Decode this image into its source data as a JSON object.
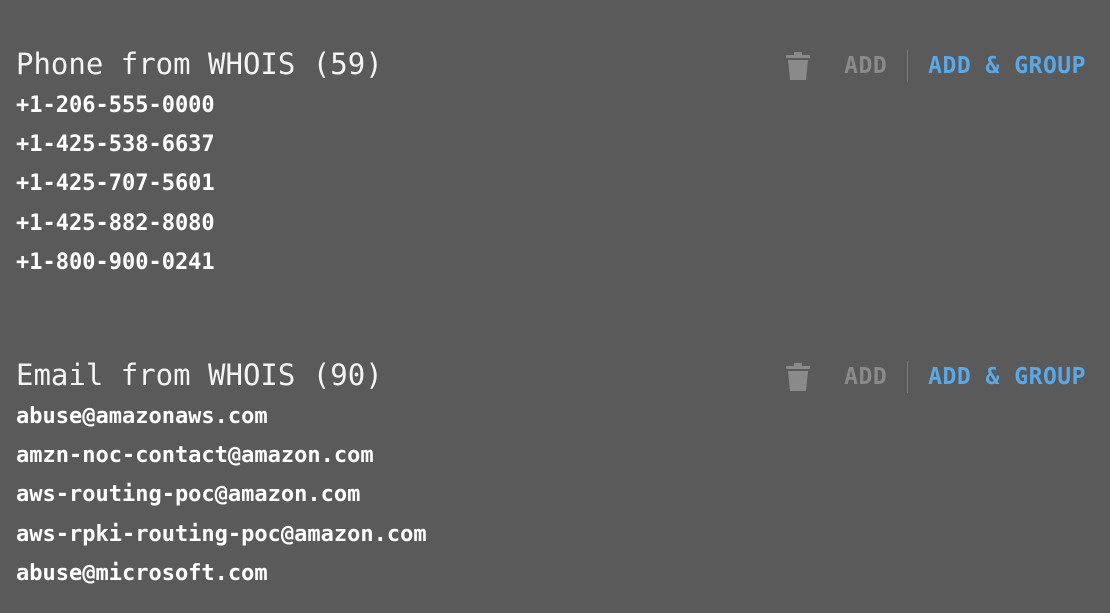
{
  "sections": [
    {
      "title": "Phone from WHOIS (59)",
      "add_label": "ADD",
      "add_group_label": "ADD & GROUP",
      "delete_icon": "trash-icon",
      "items": [
        "+1-206-555-0000",
        "+1-425-538-6637",
        "+1-425-707-5601",
        "+1-425-882-8080",
        "+1-800-900-0241"
      ]
    },
    {
      "title": "Email from WHOIS (90)",
      "add_label": "ADD",
      "add_group_label": "ADD & GROUP",
      "delete_icon": "trash-icon",
      "items": [
        "abuse@amazonaws.com",
        "amzn-noc-contact@amazon.com",
        "aws-routing-poc@amazon.com",
        "aws-rpki-routing-poc@amazon.com",
        "abuse@microsoft.com"
      ]
    }
  ],
  "colors": {
    "background": "#5a5a5a",
    "text": "#ffffff",
    "disabled_action": "#8a8a8a",
    "accent": "#5aa8e6"
  }
}
